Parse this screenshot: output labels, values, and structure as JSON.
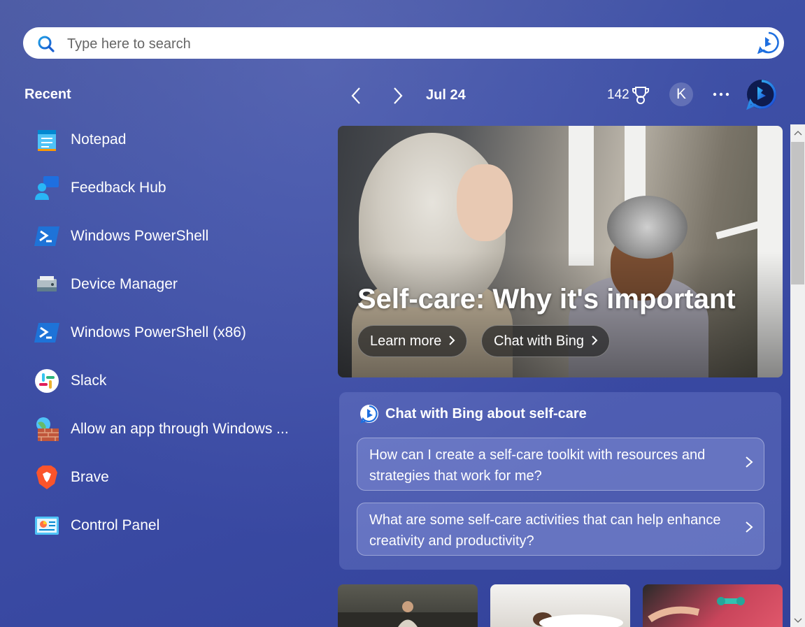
{
  "search": {
    "placeholder": "Type here to search"
  },
  "recent": {
    "title": "Recent",
    "items": [
      {
        "label": "Notepad",
        "icon": "notepad-icon"
      },
      {
        "label": "Feedback Hub",
        "icon": "feedback-hub-icon"
      },
      {
        "label": "Windows PowerShell",
        "icon": "powershell-icon"
      },
      {
        "label": "Device Manager",
        "icon": "device-manager-icon"
      },
      {
        "label": "Windows PowerShell (x86)",
        "icon": "powershell-icon"
      },
      {
        "label": "Slack",
        "icon": "slack-icon"
      },
      {
        "label": "Allow an app through Windows ...",
        "icon": "firewall-icon"
      },
      {
        "label": "Brave",
        "icon": "brave-icon"
      },
      {
        "label": "Control Panel",
        "icon": "control-panel-icon"
      }
    ]
  },
  "header": {
    "date": "Jul 24",
    "points": "142",
    "avatar_initial": "K",
    "more": "···"
  },
  "hero": {
    "title": "Self-care: Why it's important",
    "learn_more": "Learn more",
    "chat_with_bing": "Chat with Bing"
  },
  "chat": {
    "heading": "Chat with Bing about self-care",
    "questions": [
      "How can I create a self-care toolkit with resources and strategies that work for me?",
      "What are some self-care activities that can help enhance creativity and productivity?"
    ]
  },
  "colors": {
    "bing_blue": "#1a73e8",
    "background": "#3f51a6"
  }
}
